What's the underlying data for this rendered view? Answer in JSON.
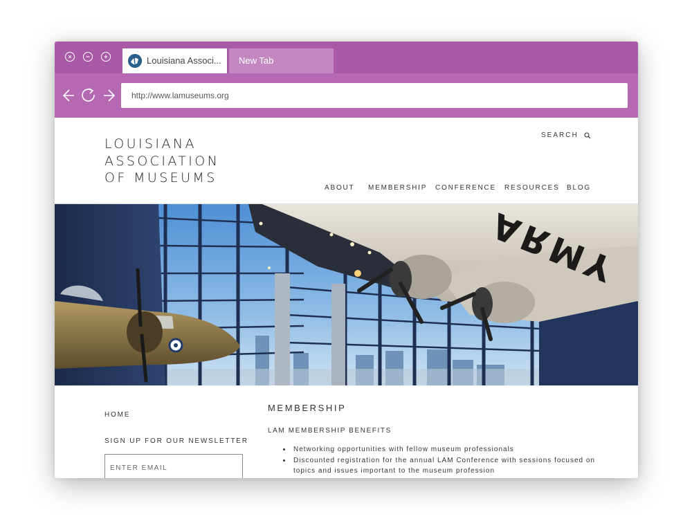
{
  "browser": {
    "tabs": [
      {
        "label": "Louisiana Associ...",
        "active": true
      },
      {
        "label": "New Tab",
        "active": false
      }
    ],
    "url": "http://www.lamuseums.org",
    "chrome_color": "#a95aa6",
    "window_controls": [
      "close-icon",
      "minimize-icon",
      "maximize-icon"
    ],
    "nav_icons": [
      "back-arrow-icon",
      "reload-icon",
      "forward-arrow-icon"
    ]
  },
  "site": {
    "logo_lines": [
      "LOUISIANA",
      "ASSOCIATION",
      "OF MUSEUMS"
    ],
    "search_label": "SEARCH",
    "nav": [
      "ABOUT",
      "MEMBERSHIP",
      "CONFERENCE",
      "RESOURCES",
      "BLOG"
    ]
  },
  "sidebar": {
    "home": "HOME",
    "newsletter_label": "SIGN UP FOR OUR NEWSLETTER",
    "email_placeholder": "ENTER EMAIL"
  },
  "content": {
    "title": "MEMBERSHIP",
    "subtitle": "LAM MEMBERSHIP BENEFITS",
    "benefits": [
      "Networking opportunities with fellow museum professionals",
      "Discounted registration for the annual LAM Conference with sessions focused on topics and issues important to the museum profession"
    ]
  },
  "hero": {
    "fuselage_text": "ARMY"
  }
}
